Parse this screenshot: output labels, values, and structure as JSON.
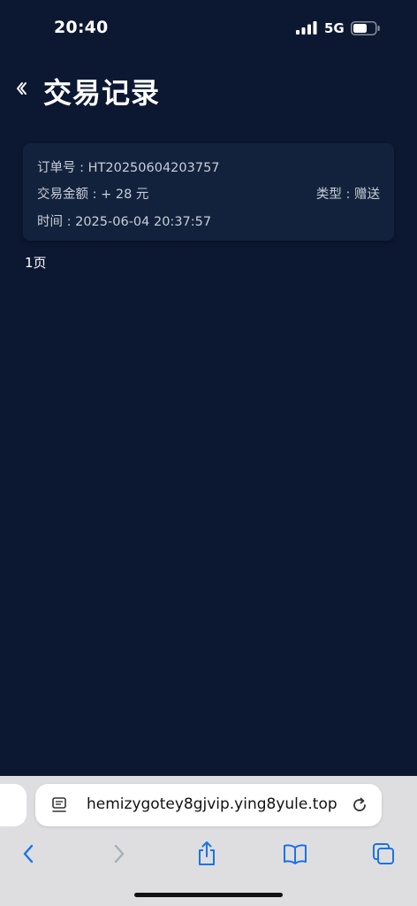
{
  "status_bar": {
    "time": "20:40",
    "network": "5G"
  },
  "header": {
    "title": "交易记录"
  },
  "records": [
    {
      "order_line": "订单号 : HT20250604203757",
      "amount_line": "交易金额 : + 28 元",
      "type_line": "类型 : 赠送",
      "time_line": "时间 : 2025-06-04 20:37:57"
    }
  ],
  "pagination": {
    "label": "1页"
  },
  "browser": {
    "url": "hemizygotey8gjvip.ying8yule.top",
    "accent_color": "#1a73e8"
  }
}
